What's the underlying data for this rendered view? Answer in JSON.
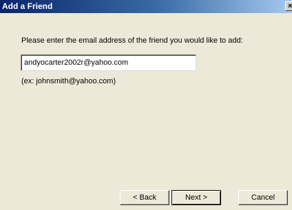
{
  "window": {
    "title": "Add a Friend",
    "close_label": "×"
  },
  "content": {
    "prompt": "Please enter the email address of the friend you would like to add:",
    "email_value": "andyocarter2002r@yahoo.com",
    "example": "(ex: johnsmith@yahoo.com)"
  },
  "buttons": {
    "back": "< Back",
    "next": "Next >",
    "cancel": "Cancel"
  },
  "colors": {
    "titlebar_start": "#0a246a",
    "titlebar_end": "#a6caf0",
    "face": "#ece9d8"
  }
}
